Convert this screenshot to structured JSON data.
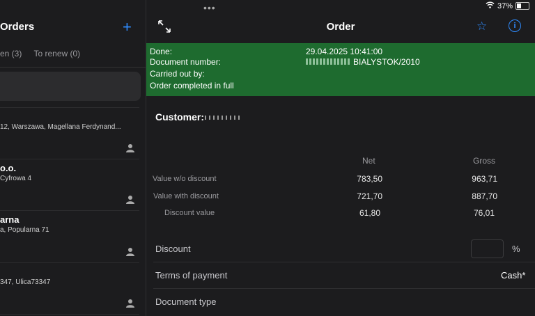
{
  "status": {
    "battery": "37%",
    "battery_level": 0.37
  },
  "left": {
    "title": "Orders",
    "tabs": [
      "en (3)",
      "To renew (0)"
    ],
    "items": [
      {
        "title": "",
        "sub": "12, Warszawa, Magellana Ferdynand..."
      },
      {
        "title": "o.o.",
        "sub": "Cyfrowa 4"
      },
      {
        "title": "arna",
        "sub": "a, Popularna 71"
      },
      {
        "title": "",
        "sub": "347, Ulica73347"
      }
    ]
  },
  "header": {
    "title": "Order"
  },
  "banner": {
    "done_label": "Done:",
    "done_value": "29.04.2025 10:41:00",
    "docnum_label": "Document number:",
    "docnum_value": "BIALYSTOK/2010",
    "carried_label": "Carried out by:",
    "completed_text": "Order completed in full"
  },
  "customer": {
    "label": "Customer:"
  },
  "values": {
    "col_net": "Net",
    "col_gross": "Gross",
    "rows": [
      {
        "label": "Value w/o discount",
        "net": "783,50",
        "gross": "963,71"
      },
      {
        "label": "Value with discount",
        "net": "721,70",
        "gross": "887,70"
      },
      {
        "label": "Discount value",
        "net": "61,80",
        "gross": "76,01"
      }
    ]
  },
  "form": {
    "discount_label": "Discount",
    "discount_unit": "%",
    "terms_label": "Terms of payment",
    "terms_value": "Cash*",
    "doctype_label": "Document type"
  },
  "colors": {
    "accent": "#2f8cff",
    "banner": "#1e6b2f",
    "background": "#1c1c1e"
  }
}
